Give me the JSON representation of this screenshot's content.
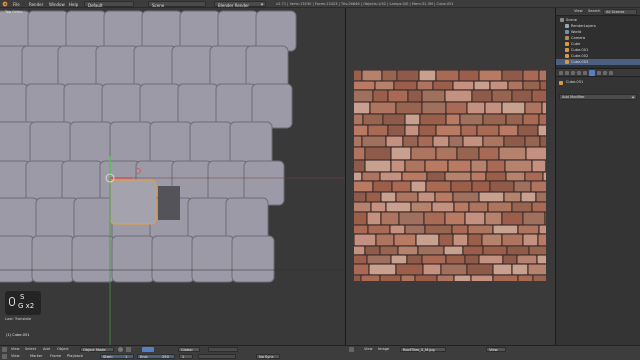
{
  "topbar": {
    "menus": [
      "File",
      "Render",
      "Window",
      "Help"
    ],
    "layout": "Default",
    "scene": "Scene",
    "engine": "Blender Render",
    "stats": "v2.71 | Verts:13530 | Faces:13423 | Tris:26846 | Objects:1/42 | Lamps:0/0 | Mem:32.3M | Cube.051"
  },
  "viewport": {
    "view_label": "Top Ortho",
    "hud_keys": [
      "S",
      "G  x2"
    ],
    "last_op": "Last: Translate",
    "object_name": "(1) Cube.051"
  },
  "viewport_header": {
    "menus": [
      "View",
      "Select",
      "Add",
      "Object"
    ],
    "mode": "Object Mode",
    "pivot": "Global"
  },
  "image_editor_header": {
    "menus": [
      "View",
      "Image"
    ],
    "image_name": "RoofTiles_S_M.jpg",
    "view_label": "View"
  },
  "outliner": {
    "header": [
      "View",
      "Search",
      "All Scenes"
    ],
    "rows": [
      {
        "label": "Scene",
        "icon_color": "#8a8a8a",
        "indent": 0
      },
      {
        "label": "RenderLayers",
        "icon_color": "#9aa7b8",
        "indent": 1
      },
      {
        "label": "World",
        "icon_color": "#6f8fb0",
        "indent": 1
      },
      {
        "label": "Camera",
        "icon_color": "#b08f5a",
        "indent": 1
      },
      {
        "label": "Cube",
        "icon_color": "#d49a48",
        "indent": 1
      },
      {
        "label": "Cube.001",
        "icon_color": "#d49a48",
        "indent": 1
      },
      {
        "label": "Cube.002",
        "icon_color": "#d49a48",
        "indent": 1
      },
      {
        "label": "Cube.003",
        "icon_color": "#d49a48",
        "indent": 1
      }
    ]
  },
  "properties": {
    "object_name": "Cube.051",
    "add_modifier_label": "Add Modifier"
  },
  "timeline": {
    "menus": [
      "View",
      "Marker",
      "Frame",
      "Playback"
    ],
    "start_label": "Start:",
    "start_value": "1",
    "end_label": "End:",
    "end_value": "250",
    "current_frame": "1",
    "sync": "No Sync"
  },
  "colors": {
    "accent_blue": "#5680c2",
    "tile": "#9b9aa6",
    "tile_edge": "#6e6d78"
  }
}
